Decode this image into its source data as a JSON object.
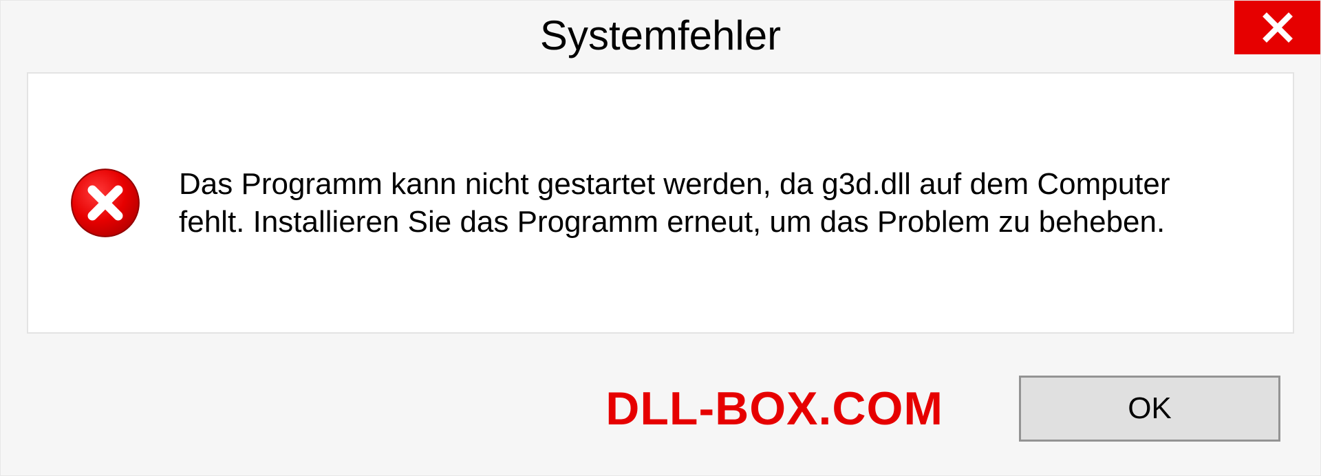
{
  "dialog": {
    "title": "Systemfehler",
    "message": "Das Programm kann nicht gestartet werden, da g3d.dll auf dem Computer fehlt. Installieren Sie das Programm erneut, um das Problem zu beheben.",
    "ok_label": "OK"
  },
  "watermark": "DLL-BOX.COM",
  "colors": {
    "close_bg": "#e60000",
    "error_circle": "#e60000",
    "watermark": "#e60000"
  }
}
